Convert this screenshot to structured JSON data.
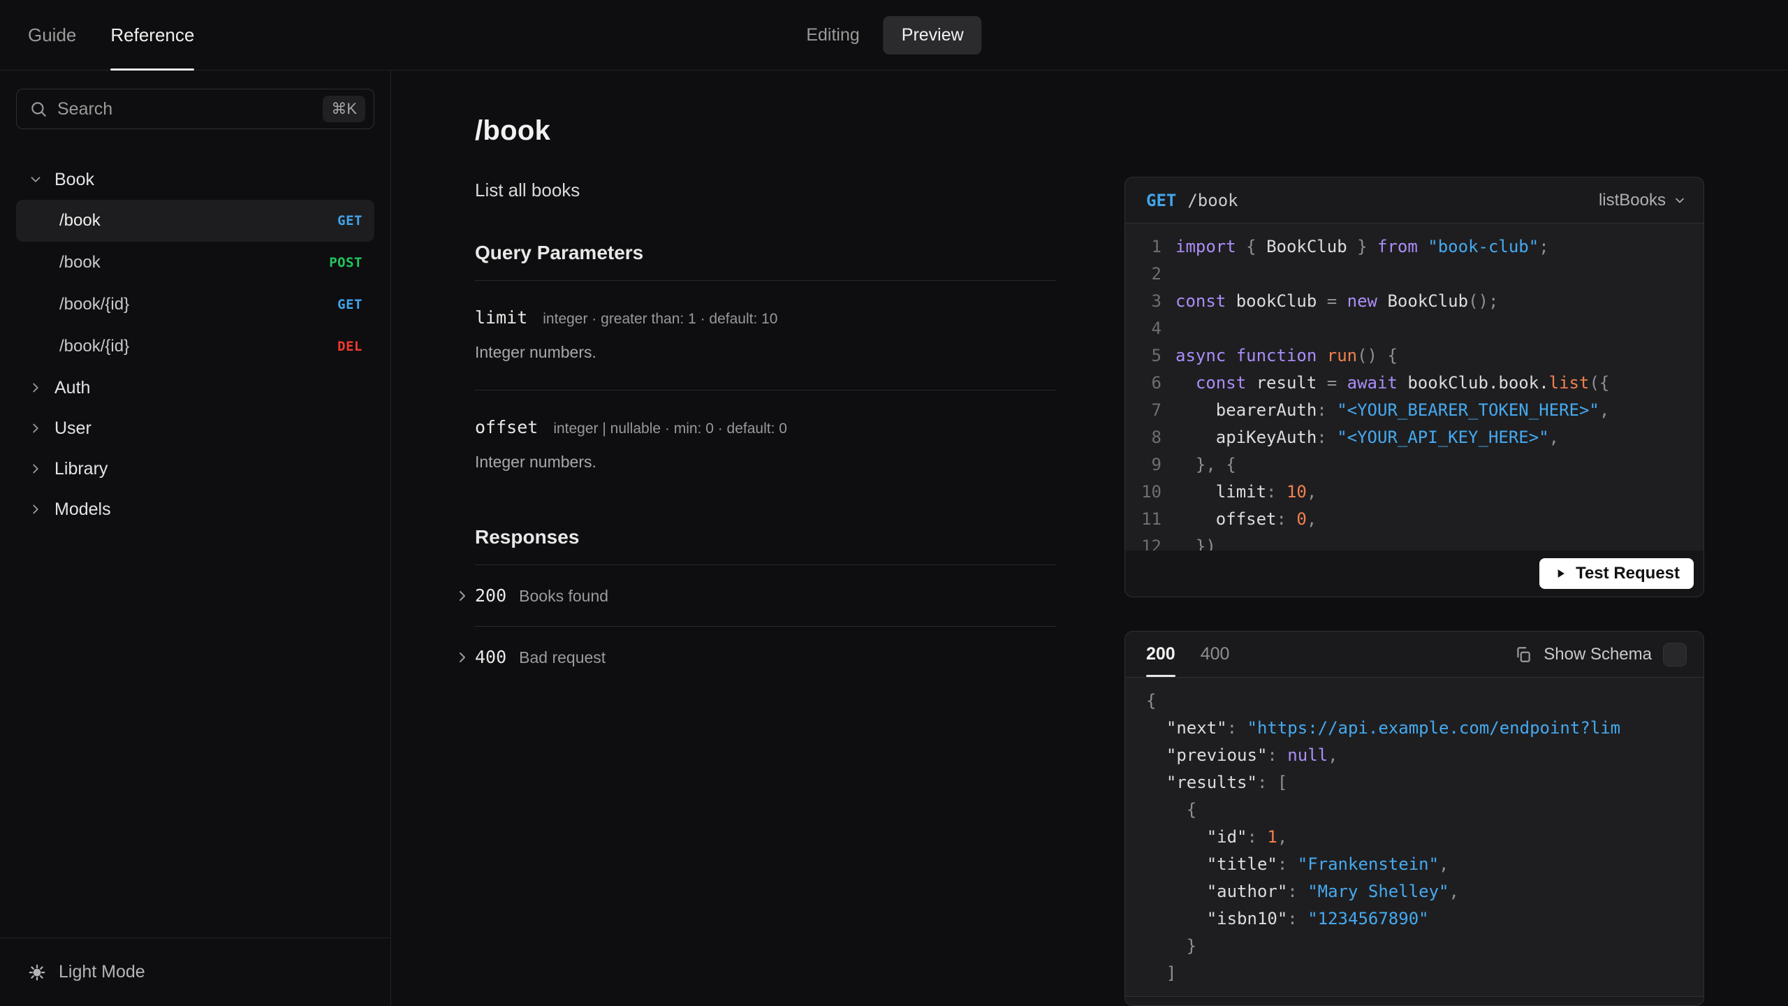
{
  "header": {
    "tabs": [
      {
        "label": "Guide",
        "active": false
      },
      {
        "label": "Reference",
        "active": true
      }
    ],
    "mode_toggle": {
      "editing_label": "Editing",
      "preview_label": "Preview"
    }
  },
  "sidebar": {
    "search": {
      "placeholder": "Search",
      "shortcut": "⌘K"
    },
    "groups": [
      {
        "label": "Book",
        "expanded": true,
        "items": [
          {
            "path": "/book",
            "method": "GET",
            "active": true
          },
          {
            "path": "/book",
            "method": "POST",
            "active": false
          },
          {
            "path": "/book/{id}",
            "method": "GET",
            "active": false
          },
          {
            "path": "/book/{id}",
            "method": "DEL",
            "active": false
          }
        ]
      },
      {
        "label": "Auth",
        "expanded": false
      },
      {
        "label": "User",
        "expanded": false
      },
      {
        "label": "Library",
        "expanded": false
      },
      {
        "label": "Models",
        "expanded": false
      }
    ],
    "footer": {
      "theme_toggle_label": "Light Mode"
    }
  },
  "content": {
    "title": "/book",
    "subtitle": "List all books",
    "query_parameters": {
      "heading": "Query Parameters",
      "params": [
        {
          "name": "limit",
          "meta": "integer · greater than: 1 · default: 10",
          "description": "Integer numbers."
        },
        {
          "name": "offset",
          "meta": "integer | nullable · min: 0 · default: 0",
          "description": "Integer numbers."
        }
      ]
    },
    "responses": {
      "heading": "Responses",
      "items": [
        {
          "code": "200",
          "description": "Books found"
        },
        {
          "code": "400",
          "description": "Bad request"
        }
      ]
    }
  },
  "request_card": {
    "method": "GET",
    "path": "/book",
    "operation": "listBooks",
    "test_button_label": "Test Request",
    "code_lines": [
      [
        [
          "kw",
          "import"
        ],
        [
          "pun",
          " { "
        ],
        [
          "pl",
          "BookClub"
        ],
        [
          "pun",
          " } "
        ],
        [
          "kw",
          "from"
        ],
        [
          "pun",
          " "
        ],
        [
          "str",
          "\"book-club\""
        ],
        [
          "pun",
          ";"
        ]
      ],
      [],
      [
        [
          "kw",
          "const"
        ],
        [
          "pl",
          " bookClub "
        ],
        [
          "pun",
          "= "
        ],
        [
          "kw",
          "new"
        ],
        [
          "pl",
          " BookClub"
        ],
        [
          "pun",
          "();"
        ]
      ],
      [],
      [
        [
          "kw",
          "async"
        ],
        [
          "pl",
          " "
        ],
        [
          "kw",
          "function"
        ],
        [
          "pl",
          " "
        ],
        [
          "fn",
          "run"
        ],
        [
          "pun",
          "() {"
        ]
      ],
      [
        [
          "pl",
          "  "
        ],
        [
          "kw",
          "const"
        ],
        [
          "pl",
          " result "
        ],
        [
          "pun",
          "= "
        ],
        [
          "kw",
          "await"
        ],
        [
          "pl",
          " bookClub.book."
        ],
        [
          "fn",
          "list"
        ],
        [
          "pun",
          "({"
        ]
      ],
      [
        [
          "pl",
          "    bearerAuth"
        ],
        [
          "pun",
          ": "
        ],
        [
          "str",
          "\"<YOUR_BEARER_TOKEN_HERE>\""
        ],
        [
          "pun",
          ","
        ]
      ],
      [
        [
          "pl",
          "    apiKeyAuth"
        ],
        [
          "pun",
          ": "
        ],
        [
          "str",
          "\"<YOUR_API_KEY_HERE>\""
        ],
        [
          "pun",
          ","
        ]
      ],
      [
        [
          "pl",
          "  "
        ],
        [
          "pun",
          "}, {"
        ]
      ],
      [
        [
          "pl",
          "    limit"
        ],
        [
          "pun",
          ": "
        ],
        [
          "num",
          "10"
        ],
        [
          "pun",
          ","
        ]
      ],
      [
        [
          "pl",
          "    offset"
        ],
        [
          "pun",
          ": "
        ],
        [
          "num",
          "0"
        ],
        [
          "pun",
          ","
        ]
      ],
      [
        [
          "pl",
          "  "
        ],
        [
          "pun",
          "})"
        ]
      ]
    ]
  },
  "response_card": {
    "tabs": [
      {
        "label": "200",
        "active": true
      },
      {
        "label": "400",
        "active": false
      }
    ],
    "show_schema_label": "Show Schema",
    "json_lines": [
      [
        [
          "pun",
          "{"
        ]
      ],
      [
        [
          "pl",
          "  \"next\""
        ],
        [
          "pun",
          ": "
        ],
        [
          "str",
          "\"https://api.example.com/endpoint?lim"
        ]
      ],
      [
        [
          "pl",
          "  \"previous\""
        ],
        [
          "pun",
          ": "
        ],
        [
          "kw",
          "null"
        ],
        [
          "pun",
          ","
        ]
      ],
      [
        [
          "pl",
          "  \"results\""
        ],
        [
          "pun",
          ": ["
        ]
      ],
      [
        [
          "pun",
          "    {"
        ]
      ],
      [
        [
          "pl",
          "      \"id\""
        ],
        [
          "pun",
          ": "
        ],
        [
          "num",
          "1"
        ],
        [
          "pun",
          ","
        ]
      ],
      [
        [
          "pl",
          "      \"title\""
        ],
        [
          "pun",
          ": "
        ],
        [
          "str",
          "\"Frankenstein\""
        ],
        [
          "pun",
          ","
        ]
      ],
      [
        [
          "pl",
          "      \"author\""
        ],
        [
          "pun",
          ": "
        ],
        [
          "str",
          "\"Mary Shelley\""
        ],
        [
          "pun",
          ","
        ]
      ],
      [
        [
          "pl",
          "      \"isbn10\""
        ],
        [
          "pun",
          ": "
        ],
        [
          "str",
          "\"1234567890\""
        ]
      ],
      [
        [
          "pun",
          "    }"
        ]
      ],
      [
        [
          "pun",
          "  ]"
        ]
      ]
    ]
  },
  "colors": {
    "methods": {
      "GET": "#42a4ea",
      "POST": "#22c55e",
      "DEL": "#ef3b2d"
    },
    "background": "#0e0e10",
    "card_background": "#1e1e20",
    "accent_text": "#f2f2f2"
  }
}
